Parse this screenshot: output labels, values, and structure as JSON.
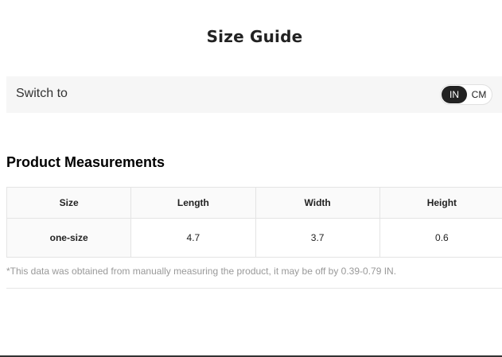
{
  "header": {
    "title": "Size Guide"
  },
  "unit_switch": {
    "label": "Switch to",
    "options": [
      "IN",
      "CM"
    ],
    "selected": "IN"
  },
  "measurements": {
    "title": "Product Measurements",
    "columns": [
      "Size",
      "Length",
      "Width",
      "Height"
    ],
    "rows": [
      [
        "one-size",
        "4.7",
        "3.7",
        "0.6"
      ]
    ],
    "note": "*This data was obtained from manually measuring the product, it may be off by 0.39-0.79 IN."
  },
  "colors": {
    "toggle_active_bg": "#222222",
    "switch_bar_bg": "#f6f6f6",
    "note_text": "#999999"
  }
}
